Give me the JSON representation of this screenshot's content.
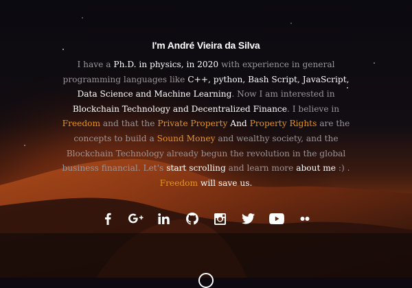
{
  "title": "I'm André Vieira da Silva",
  "bio": {
    "p1": "I have a ",
    "phd": "Ph.D. in physics, in 2020",
    "p2": " with experience in general programming languages like ",
    "langs": "C++, python, Bash Script, JavaScript, Data Science and Machine Learning",
    "p3": ". Now I am interested in ",
    "blockchain": "Blockchain Technology and Decentralized Finance",
    "p4": ". I believe in ",
    "freedom": "Freedom",
    "p5": " and that the ",
    "private_property": "Private Property",
    "and": " And ",
    "property_rights": "Property Rights",
    "p6": " are the concepts to build a ",
    "sound_money": "Sound Money",
    "p7": " and wealthy society, and the Blockchain Technology already begun the revolution in the global business financial. Let's ",
    "start_scrolling": "start scrolling",
    "p8": " and learn more ",
    "about_me": "about me",
    "p9": " :) .",
    "freedom2": "Freedom",
    "save_us": " will save us."
  },
  "social": [
    "facebook-icon",
    "google-plus-icon",
    "linkedin-icon",
    "github-icon",
    "instagram-icon",
    "twitter-icon",
    "youtube-icon",
    "flickr-icon"
  ],
  "colors": {
    "accent": "#e7941f",
    "muted": "#9b9699",
    "white": "#ffffff"
  }
}
